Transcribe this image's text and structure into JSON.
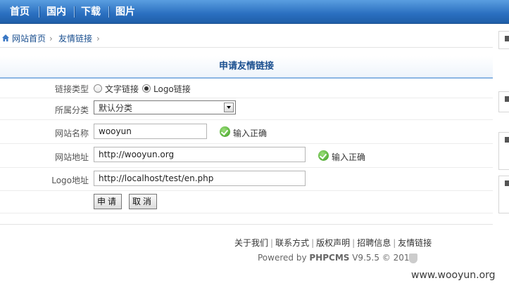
{
  "nav": {
    "items": [
      "首页",
      "国内",
      "下载",
      "图片"
    ]
  },
  "breadcrumb": {
    "home": "网站首页",
    "current": "友情链接"
  },
  "panel": {
    "title": "申请友情链接"
  },
  "form": {
    "link_type": {
      "label": "链接类型",
      "options": [
        "文字链接",
        "Logo链接"
      ],
      "selected": "Logo链接"
    },
    "category": {
      "label": "所属分类",
      "value": "默认分类"
    },
    "site_name": {
      "label": "网站名称",
      "value": "wooyun",
      "status": "输入正确"
    },
    "site_url": {
      "label": "网站地址",
      "value": "http://wooyun.org",
      "status": "输入正确"
    },
    "logo_url": {
      "label": "Logo地址",
      "value": "http://localhost/test/en.php"
    },
    "submit_label": "申请",
    "cancel_label": "取消"
  },
  "footer": {
    "links": [
      "关于我们",
      "联系方式",
      "版权声明",
      "招聘信息",
      "友情链接"
    ],
    "powered_prefix": "Powered by ",
    "powered_brand": "PHPCMS",
    "powered_suffix": " V9.5.5 © 2011"
  },
  "watermark": "www.wooyun.org",
  "colors": {
    "nav_bg": "#2a6fc0",
    "title_text": "#1a4f8f",
    "ok_green": "#3a9a1e"
  }
}
